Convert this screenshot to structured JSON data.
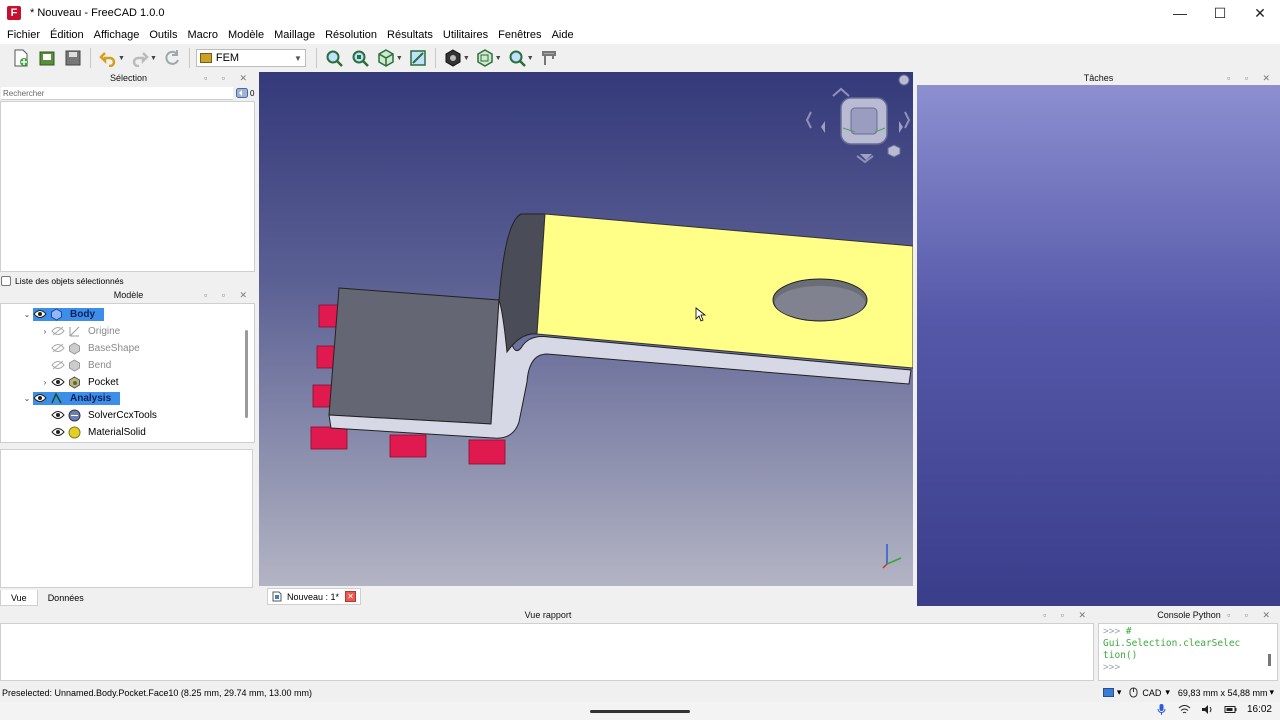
{
  "window": {
    "title": "* Nouveau - FreeCAD 1.0.0",
    "logo_letter": "F",
    "minimize": "—",
    "maximize": "☐",
    "close": "✕"
  },
  "menu": [
    "Fichier",
    "Édition",
    "Affichage",
    "Outils",
    "Macro",
    "Modèle",
    "Maillage",
    "Résolution",
    "Résultats",
    "Utilitaires",
    "Fenêtres",
    "Aide"
  ],
  "toolbar": {
    "workbench": "FEM"
  },
  "selection_panel": {
    "title": "Sélection",
    "search_placeholder": "Rechercher",
    "count": "0",
    "list_checkbox_label": "Liste des objets sélectionnés"
  },
  "model_panel": {
    "title": "Modèle",
    "tree": [
      {
        "label": "Body",
        "depth": 0,
        "expanded": true,
        "selected": true,
        "visible": true,
        "dim": false,
        "icon": "body-icon"
      },
      {
        "label": "Origine",
        "depth": 1,
        "expanded": false,
        "selected": false,
        "visible": false,
        "dim": true,
        "icon": "origin-icon"
      },
      {
        "label": "BaseShape",
        "depth": 1,
        "expanded": null,
        "selected": false,
        "visible": false,
        "dim": true,
        "icon": "baseshape-icon"
      },
      {
        "label": "Bend",
        "depth": 1,
        "expanded": null,
        "selected": false,
        "visible": false,
        "dim": true,
        "icon": "bend-icon"
      },
      {
        "label": "Pocket",
        "depth": 1,
        "expanded": false,
        "selected": false,
        "visible": true,
        "dim": false,
        "icon": "pocket-icon"
      },
      {
        "label": "Analysis",
        "depth": 0,
        "expanded": true,
        "selected": true,
        "visible": true,
        "dim": false,
        "icon": "analysis-icon"
      },
      {
        "label": "SolverCcxTools",
        "depth": 1,
        "expanded": null,
        "selected": false,
        "visible": true,
        "dim": false,
        "icon": "solver-icon"
      },
      {
        "label": "MaterialSolid",
        "depth": 1,
        "expanded": null,
        "selected": false,
        "visible": true,
        "dim": false,
        "icon": "material-icon"
      }
    ]
  },
  "left_tabs": [
    "Vue",
    "Données"
  ],
  "document_tab": {
    "label": "Nouveau : 1*",
    "close": "✕"
  },
  "tasks_panel": {
    "title": "Tâches"
  },
  "report_panel": {
    "title": "Vue rapport"
  },
  "python_console": {
    "title": "Console Python",
    "lines": [
      {
        "prompt": ">>> ",
        "text": "#"
      },
      {
        "prompt": "",
        "text": "Gui.Selection.clearSelec"
      },
      {
        "prompt": "",
        "text": "tion()"
      },
      {
        "prompt": ">>> ",
        "text": ""
      }
    ]
  },
  "status": {
    "text": "Preselected: Unnamed.Body.Pocket.Face10 (8.25 mm, 29.74 mm, 13.00 mm)",
    "nav_style": "CAD",
    "dimensions": "69,83 mm x 54,88 mm"
  },
  "system": {
    "time": "16:02"
  },
  "colors": {
    "accent_selected": "#3d8ee8",
    "part_face": "#ffff88",
    "constraint": "#e0194f",
    "background_top": "#34397a"
  }
}
